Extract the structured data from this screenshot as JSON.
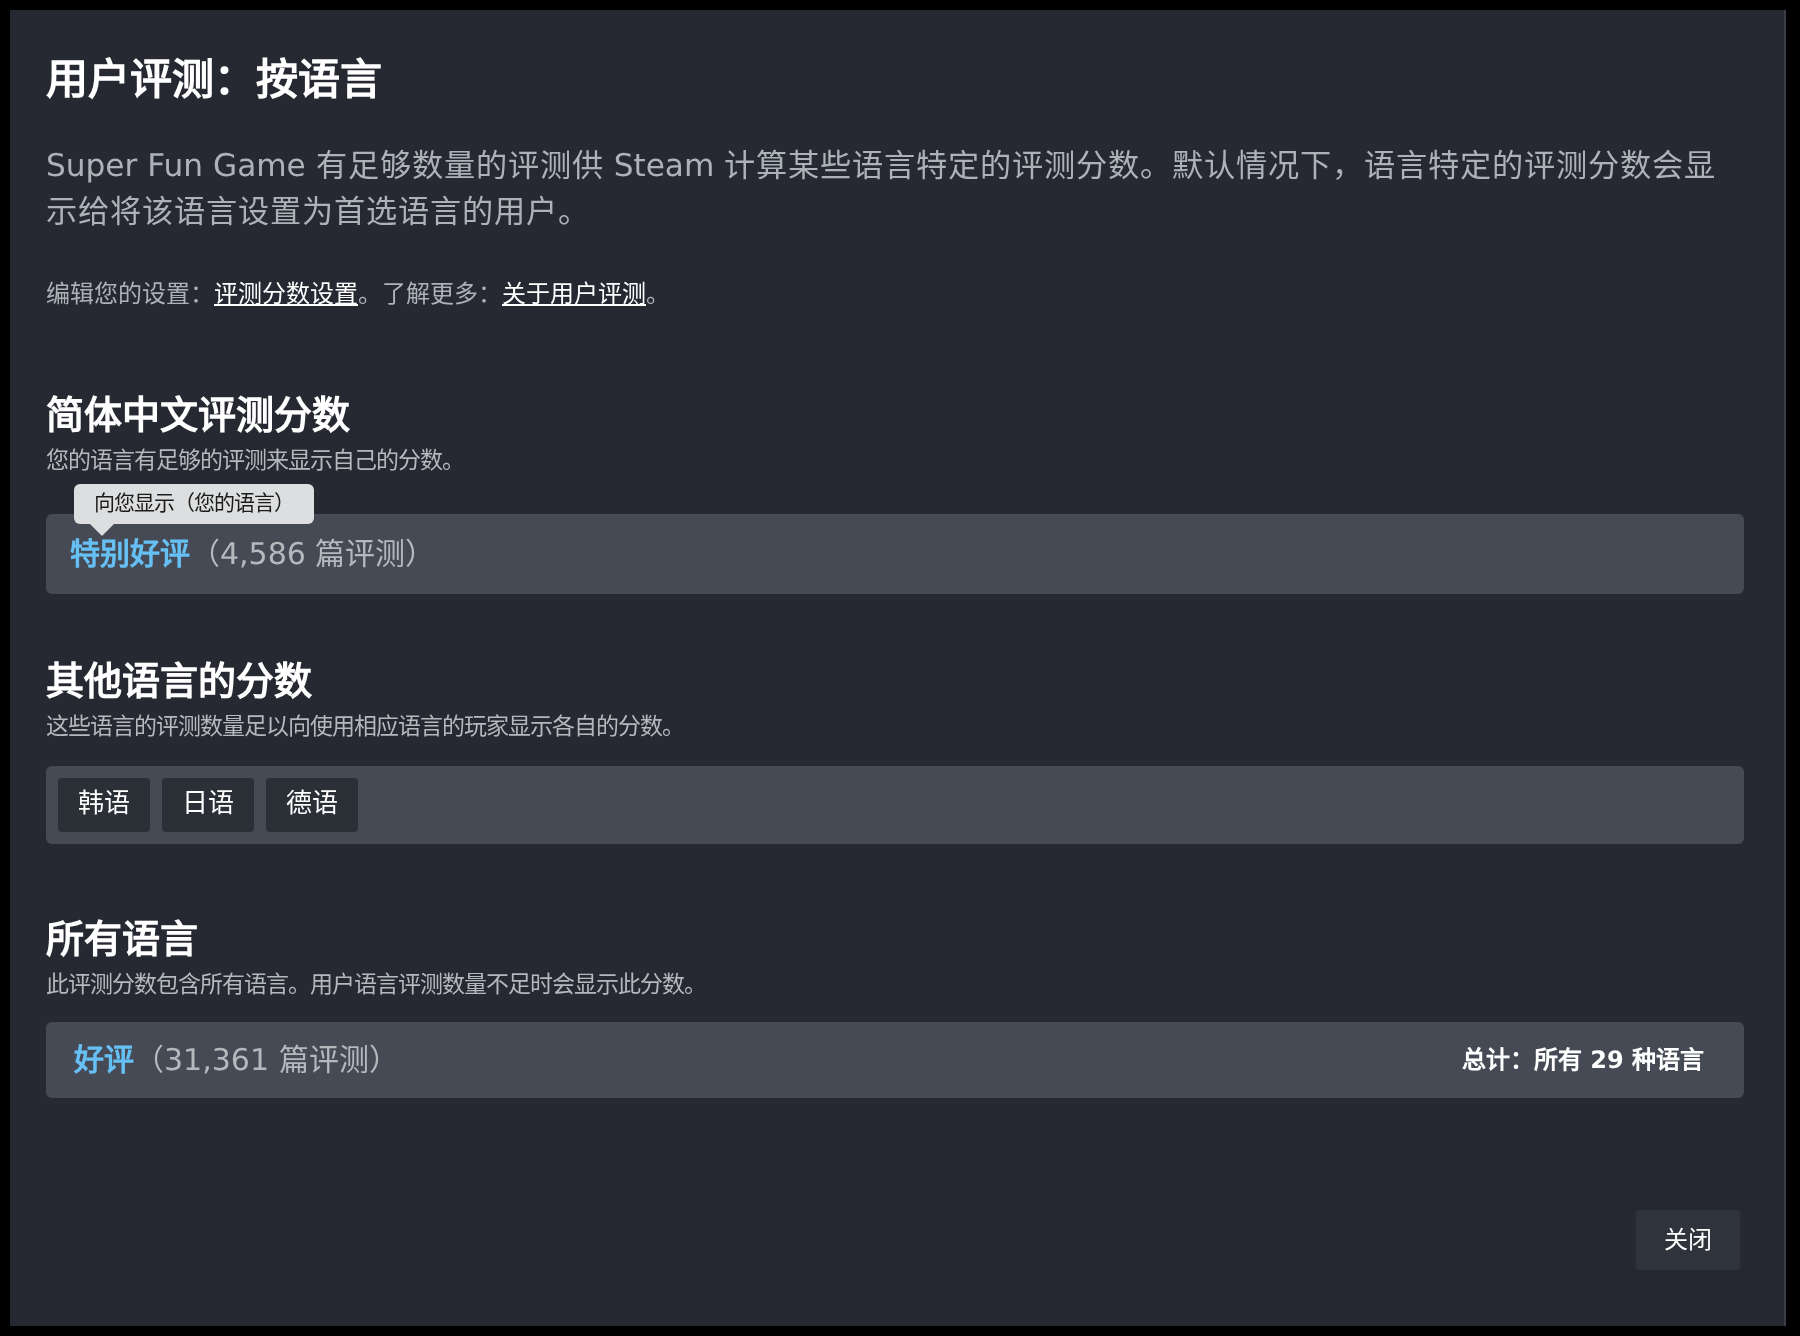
{
  "dialog": {
    "title": "用户评测：按语言",
    "description": "Super Fun Game 有足够数量的评测供 Steam 计算某些语言特定的评测分数。默认情况下，语言特定的评测分数会显示给将该语言设置为首选语言的用户。",
    "settings_note": [
      {
        "kind": "text",
        "text": "编辑您的设置："
      },
      {
        "kind": "link",
        "text": "评测分数设置"
      },
      {
        "kind": "text",
        "text": "。了解更多："
      },
      {
        "kind": "link",
        "text": "关于用户评测"
      },
      {
        "kind": "text",
        "text": "。"
      }
    ],
    "sections": [
      {
        "kind": "score",
        "heading": "简体中文评测分数",
        "subtitle": "您的语言有足够的评测来显示自己的分数。",
        "tooltip": "向您显示（您的语言）",
        "rating": "特别好评",
        "count": "（4,586 篇评测）"
      },
      {
        "kind": "languages",
        "heading": "其他语言的分数",
        "subtitle": "这些语言的评测数量足以向使用相应语言的玩家显示各自的分数。",
        "languages": [
          "韩语",
          "日语",
          "德语"
        ]
      },
      {
        "kind": "score",
        "heading": "所有语言",
        "subtitle": "此评测分数包含所有语言。用户语言评测数量不足时会显示此分数。",
        "rating": "好评",
        "count": "（31,361 篇评测）",
        "total": "总计：所有 29 种语言"
      }
    ],
    "close_button": "关闭"
  }
}
